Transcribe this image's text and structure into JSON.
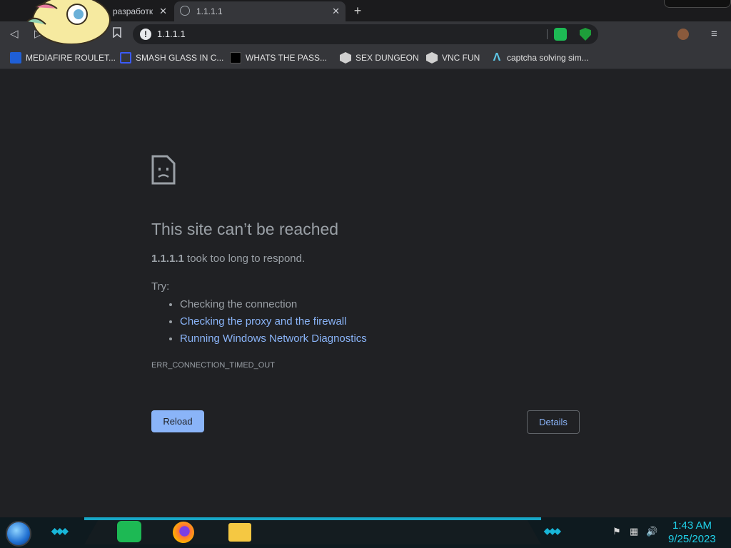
{
  "tabs": [
    {
      "title": "разработк",
      "active": false
    },
    {
      "title": "1.1.1.1",
      "active": true
    }
  ],
  "omnibox": {
    "url": "1.1.1.1"
  },
  "bookmarks": [
    {
      "label": "MEDIAFIRE ROULET...",
      "icon": "mediafire-icon",
      "color": "#1f5fd6"
    },
    {
      "label": "SMASH GLASS IN C...",
      "icon": "smash-icon",
      "color": "#3b5bff"
    },
    {
      "label": "WHATS THE PASS...",
      "icon": "password-icon",
      "color": "#000000"
    },
    {
      "label": "SEX DUNGEON",
      "icon": "cube-icon",
      "color": "#d0d0d0"
    },
    {
      "label": "VNC FUN",
      "icon": "cube-icon",
      "color": "#d0d0d0"
    },
    {
      "label": "captcha solving sim...",
      "icon": "lambda-icon",
      "color": "#5ec8e8"
    }
  ],
  "error": {
    "title": "This site can’t be reached",
    "host": "1.1.1.1",
    "message": " took too long to respond.",
    "try_label": "Try:",
    "suggestions": [
      {
        "text": "Checking the connection",
        "link": false
      },
      {
        "text": "Checking the proxy and the firewall",
        "link": true
      },
      {
        "text": "Running Windows Network Diagnostics",
        "link": true
      }
    ],
    "code": "ERR_CONNECTION_TIMED_OUT",
    "reload_label": "Reload",
    "details_label": "Details"
  },
  "taskbar": {
    "clock_time": "1:43 AM",
    "clock_date": "9/25/2023",
    "apps": [
      "spotify-icon",
      "firefox-icon",
      "file-explorer-icon"
    ]
  },
  "colors": {
    "background": "#202124",
    "link": "#8ab4f8",
    "accent": "#17a7c7"
  }
}
